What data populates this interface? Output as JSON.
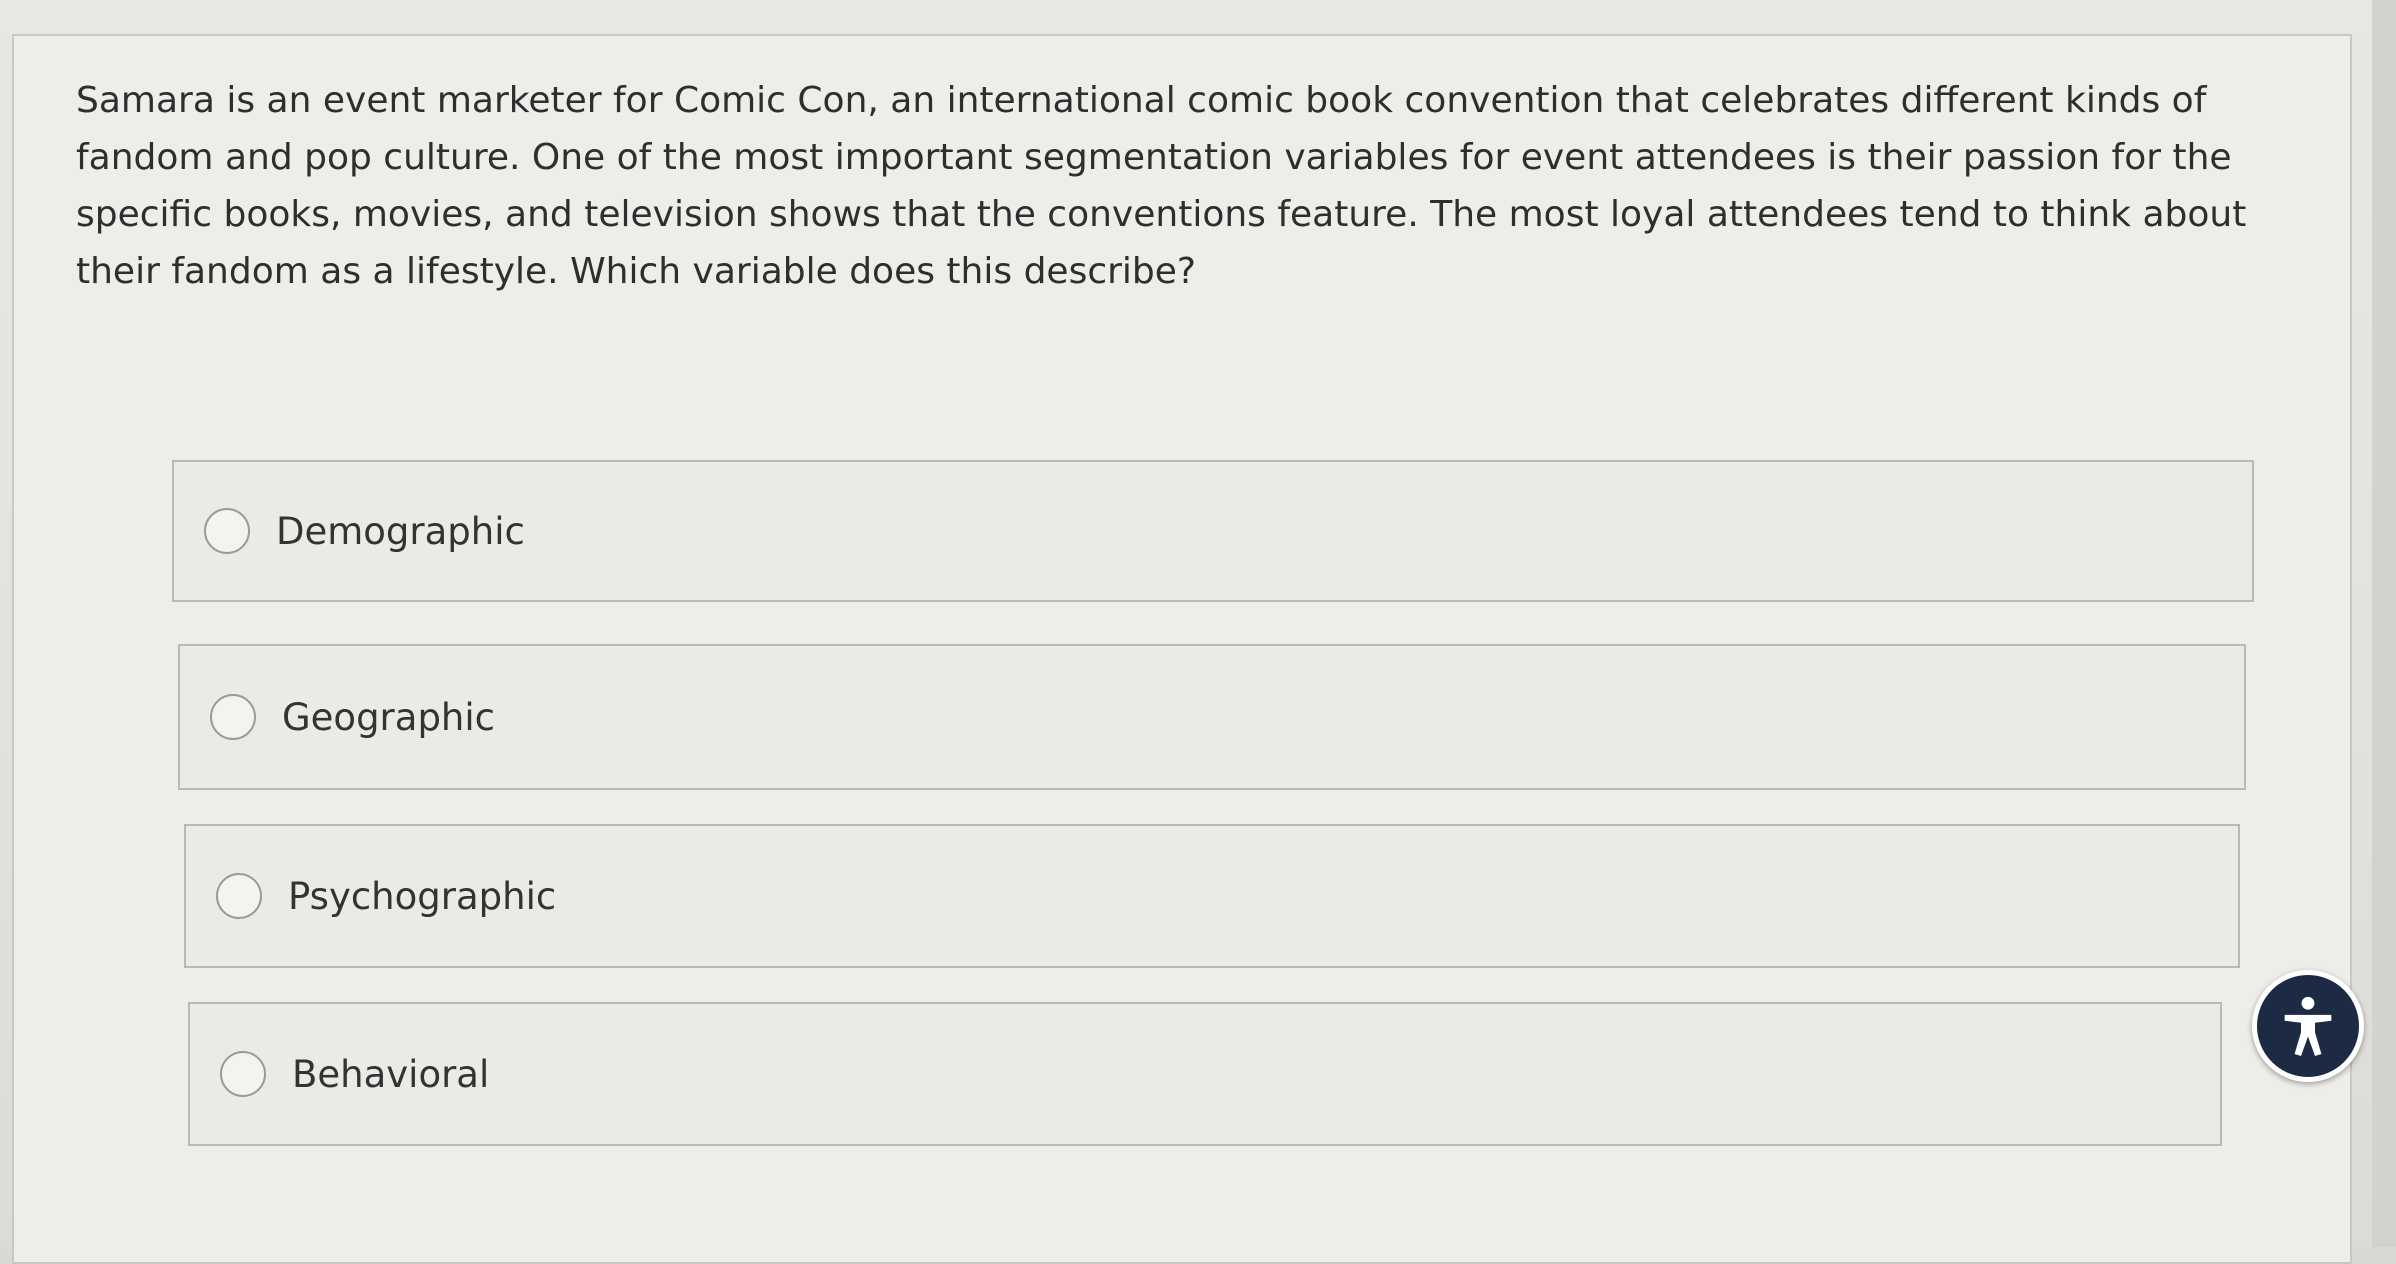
{
  "question": {
    "text": "Samara is an event marketer for Comic Con, an international comic book convention that celebrates different kinds of fandom and pop culture. One of the most important segmentation variables for event attendees is their passion for the specific books, movies, and television shows that the conventions feature. The most loyal attendees tend to think about their fandom as a lifestyle. Which variable does this describe?"
  },
  "options": [
    {
      "label": "Demographic",
      "selected": false
    },
    {
      "label": "Geographic",
      "selected": false
    },
    {
      "label": "Psychographic",
      "selected": false
    },
    {
      "label": "Behavioral",
      "selected": false
    }
  ],
  "accessibility": {
    "icon": "accessibility-icon",
    "color": "#1c2a44"
  }
}
